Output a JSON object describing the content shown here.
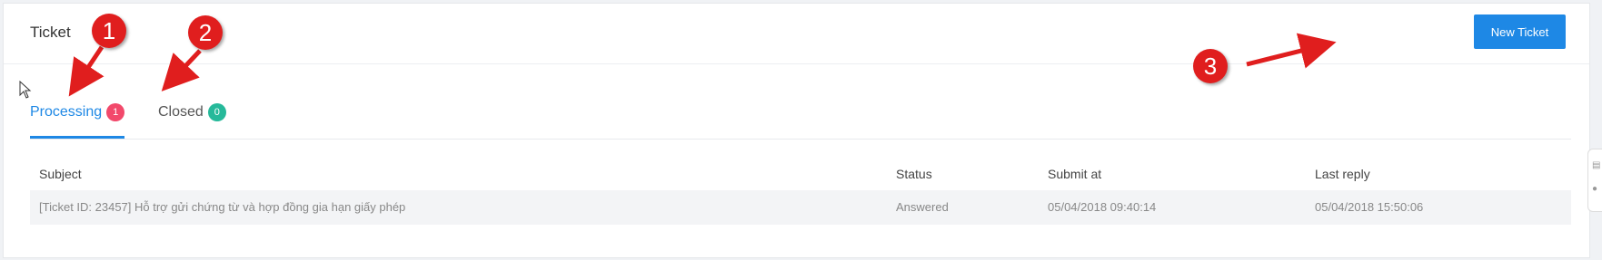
{
  "header": {
    "title": "Ticket",
    "new_ticket_label": "New Ticket"
  },
  "tabs": [
    {
      "label": "Processing",
      "count": "1",
      "active": true,
      "badge_color": "#f2496b"
    },
    {
      "label": "Closed",
      "count": "0",
      "active": false,
      "badge_color": "#26b99a"
    }
  ],
  "table": {
    "columns": [
      "Subject",
      "Status",
      "Submit at",
      "Last reply"
    ],
    "rows": [
      {
        "subject": "[Ticket ID: 23457] Hỗ trợ gửi chứng từ và hợp đồng gia hạn giấy phép",
        "status": "Answered",
        "submit_at": "05/04/2018 09:40:14",
        "last_reply": "05/04/2018 15:50:06"
      }
    ]
  },
  "annotations": [
    "1",
    "2",
    "3"
  ],
  "accent": "#1e88e5",
  "annotation_color": "#e01e1e"
}
